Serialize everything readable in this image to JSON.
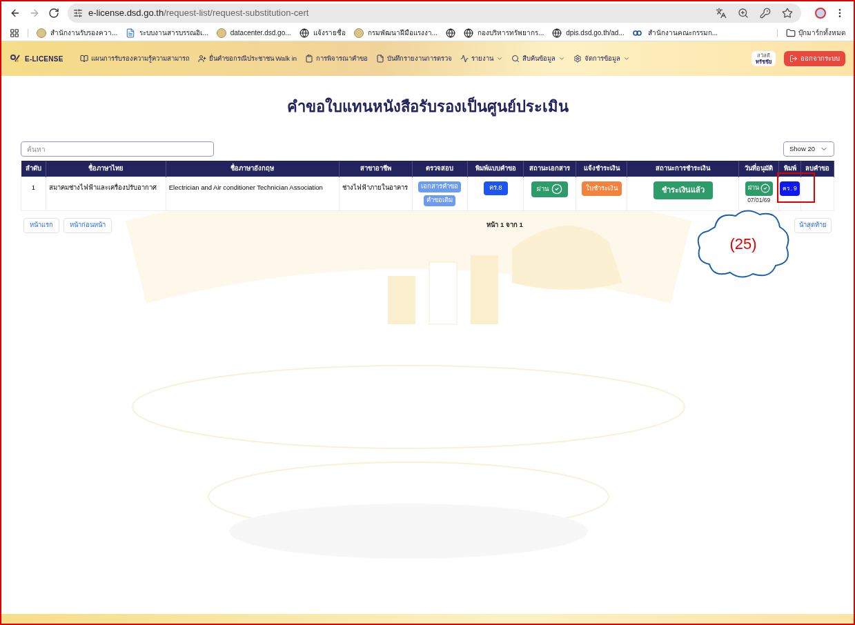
{
  "browser": {
    "url_host": "e-license.dsd.go.th",
    "url_path": "/request-list/request-substitution-cert"
  },
  "bookmarks": [
    {
      "label": "สำนักงานรับรองควา...",
      "kind": "seal"
    },
    {
      "label": "ระบบงานสารบรรณอิเ...",
      "kind": "doc"
    },
    {
      "label": "datacenter.dsd.go...",
      "kind": "seal"
    },
    {
      "label": "แจ้งรายชื่อ",
      "kind": "globe"
    },
    {
      "label": "กรมพัฒนาฝีมือแรงงา...",
      "kind": "seal"
    },
    {
      "kind": "globe"
    },
    {
      "label": "กองบริหารทรัพยากร...",
      "kind": "globe"
    },
    {
      "label": "dpis.dsd.go.th/ad...",
      "kind": "globe"
    },
    {
      "label": "สำนักงานคณะกรรมก...",
      "kind": "ocs"
    }
  ],
  "all_bookmarks": "บุ๊กมาร์กทั้งหมด",
  "navbar": {
    "brand": "E-LICENSE",
    "items": [
      {
        "label": "แผนการรับรองความรู้ความสามารถ",
        "dropdown": false
      },
      {
        "label": "ยื่นคำขอกรณีประชาชน Walk in",
        "dropdown": false
      },
      {
        "label": "การพิจารณาคำขอ",
        "dropdown": false
      },
      {
        "label": "บันทึกรายงานการตรวจ",
        "dropdown": false
      },
      {
        "label": "รายงาน",
        "dropdown": true
      },
      {
        "label": "สืบค้นข้อมูล",
        "dropdown": true
      },
      {
        "label": "จัดการข้อมูล",
        "dropdown": true
      }
    ],
    "greeting": "สวัสดี",
    "user": "ทรัชชัย",
    "logout": "ออกจากระบบ"
  },
  "page_title": "คำขอใบแทนหนังสือรับรองเป็นศูนย์ประเมิน",
  "search": {
    "placeholder": "ค้นหา"
  },
  "page_size": "Show 20",
  "table": {
    "columns": [
      "ลำดับ",
      "ชื่อภาษาไทย",
      "ชื่อภาษาอังกฤษ",
      "สาขาอาชีพ",
      "ตรวจสอบ",
      "พิมพ์แบบคำขอ",
      "สถานะเอกสาร",
      "แจ้งชำระเงิน",
      "สถานะการชำระเงิน",
      "วันที่อนุมัติ",
      "พิมพ์",
      "ลบคำขอ"
    ],
    "rows": [
      {
        "no": "1",
        "name_th": "สมาคมช่างไฟฟ้าและเครื่องปรับอากาศ",
        "name_en": "Electrician and Air conditioner Technician Association",
        "branch": "ช่างไฟฟ้าภายในอาคาร",
        "check_links": [
          "เอกสารคำขอ",
          "คำขอเดิม"
        ],
        "form": "คร.8",
        "doc_status": "ผ่าน",
        "invoice": "ใบชำระเงิน",
        "payment_status": "ชำระเงินแล้ว",
        "approval": "ผ่าน",
        "approval_date": "07/01/69",
        "print": "คร. 9"
      }
    ]
  },
  "pagination": {
    "first": "หน้าแรก",
    "prev": "หน้าก่อนหน้า",
    "info": "หน้า 1 จาก 1",
    "last": "น้าสุดท้าย"
  },
  "annotation": {
    "label": "(25)"
  }
}
